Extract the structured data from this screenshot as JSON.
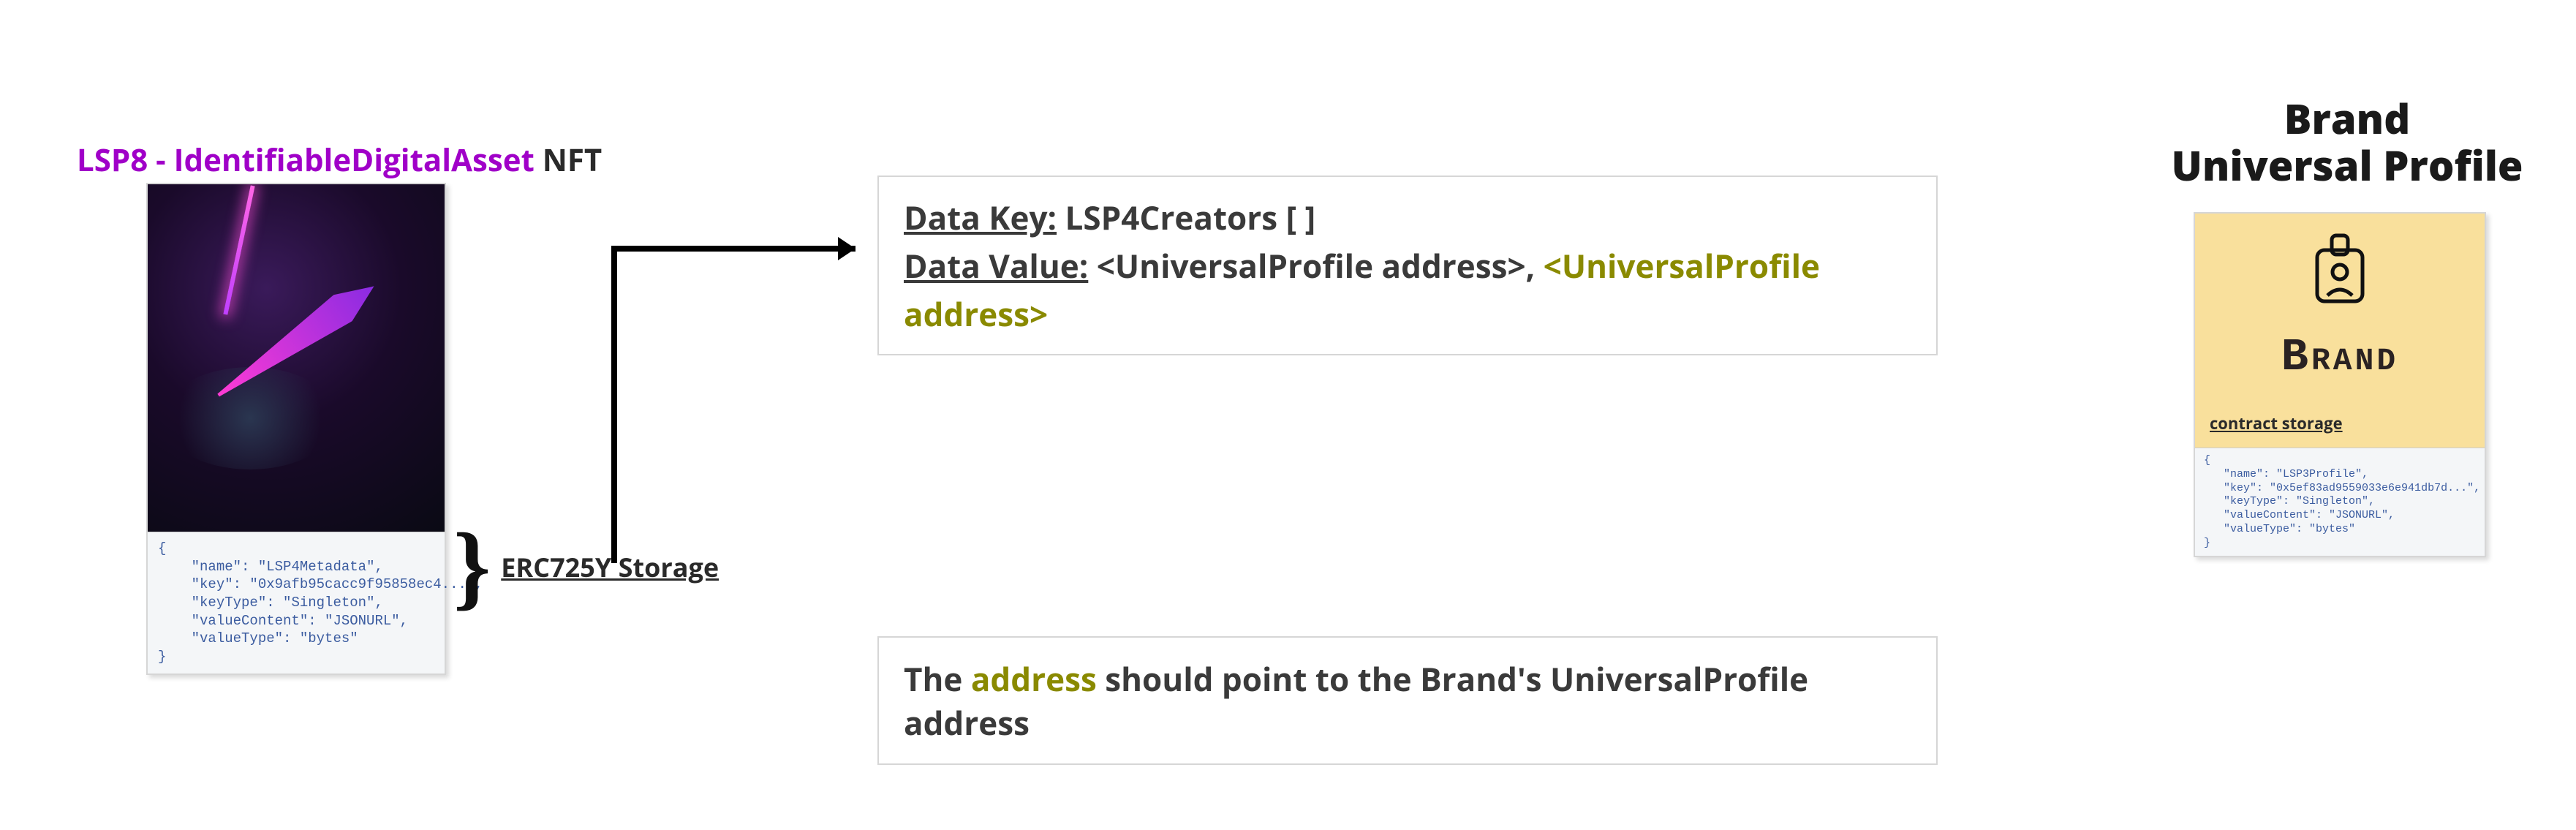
{
  "nft_title": {
    "prefix": "LSP8 - IdentifiableDigitalAsset",
    "suffix": " NFT"
  },
  "nft_json": {
    "name": "LSP4Metadata",
    "key": "0x9afb95cacc9f95858ec4...",
    "keyType": "Singleton",
    "valueContent": "JSONURL",
    "valueType": "bytes"
  },
  "storage_label": "ERC725Y Storage",
  "data_key_label": "Data Key:",
  "data_key_value": " LSP4Creators [ ]",
  "data_value_label": "Data Value:",
  "data_value_1": " <UniversalProfile address>, ",
  "data_value_2": "<UniversalProfile address>",
  "hint_1": "The ",
  "hint_em": "address",
  "hint_2": " should point to the Brand's UniversalProfile address",
  "brand_title_line1": "Brand",
  "brand_title_line2": "Universal Profile",
  "brand_name": "Brand",
  "contract_storage": "contract storage",
  "brand_json": {
    "name": "LSP3Profile",
    "key": "0x5ef83ad9559033e6e941db7d...",
    "keyType": "Singleton",
    "valueContent": "JSONURL",
    "valueType": "bytes"
  }
}
